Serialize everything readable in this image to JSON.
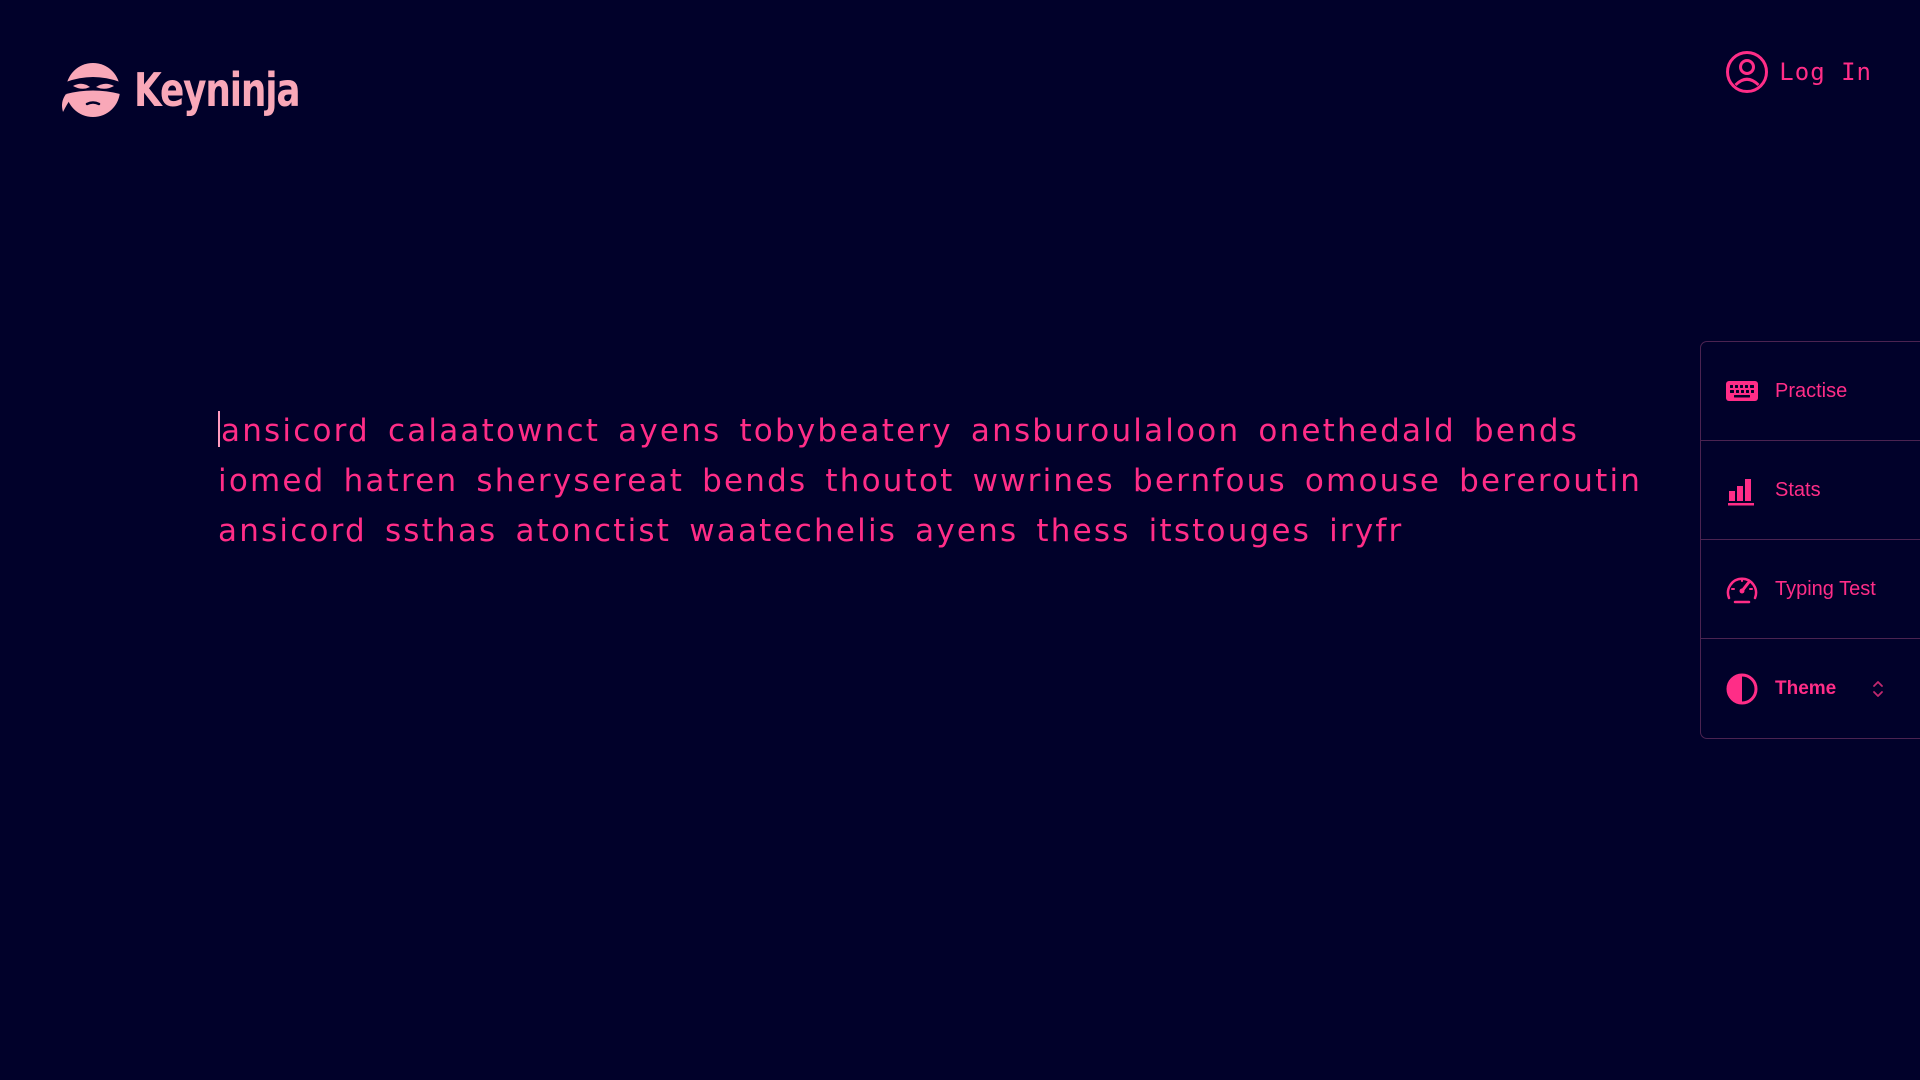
{
  "brand": {
    "name": "Keyninja",
    "icon": "ninja-head-icon"
  },
  "header": {
    "login_label": "Log In",
    "login_icon": "user-circle-icon"
  },
  "typing_test": {
    "lines": [
      "ansicord calaatownct ayens tobybeatery ansburoulaloon onethedald bends",
      "iomed hatren sherysereat bends thoutot wwrines bernfous omouse bereroutin",
      "ansicord ssthas atonctist waatechelis ayens thess itstouges iryfr"
    ]
  },
  "sidebar": {
    "items": [
      {
        "label": "Practise",
        "icon": "keyboard-icon"
      },
      {
        "label": "Stats",
        "icon": "bar-chart-icon"
      },
      {
        "label": "Typing Test",
        "icon": "speedometer-icon"
      },
      {
        "label": "Theme",
        "icon": "half-circle-contrast-icon"
      }
    ]
  },
  "colors": {
    "background": "#01012a",
    "accent": "#ff2d87",
    "brand": "#f9a8b8",
    "border": "#4b2351"
  }
}
